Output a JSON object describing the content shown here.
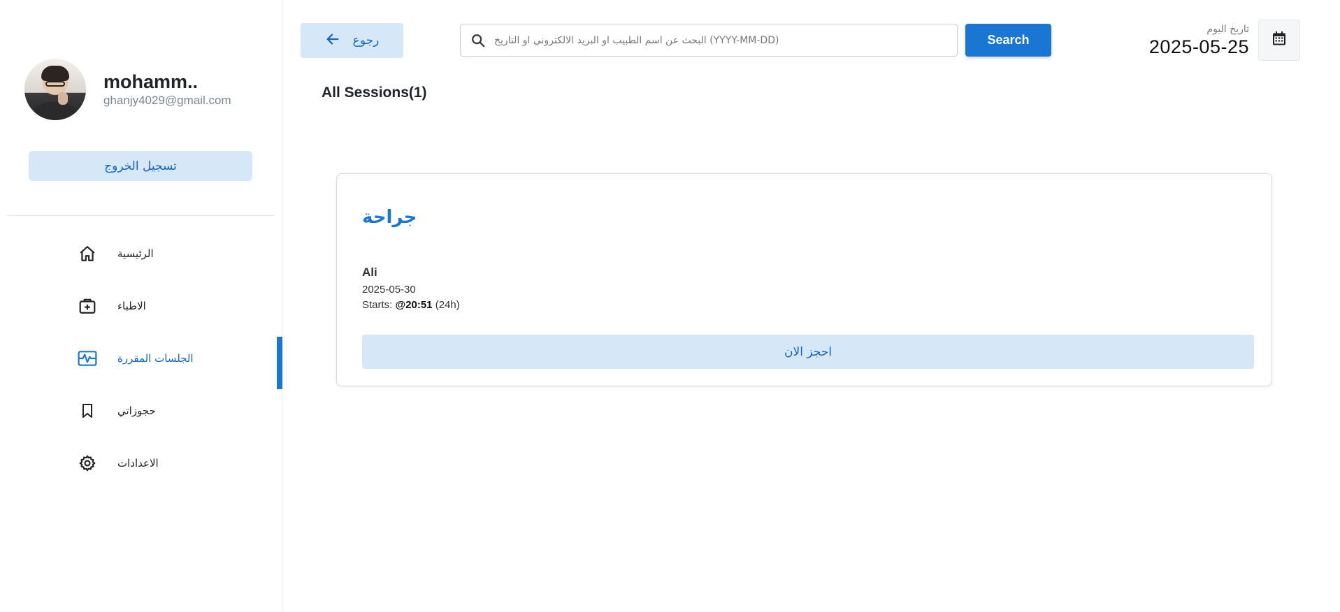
{
  "user": {
    "name": "mohamm..",
    "email": "ghanjy4029@gmail.com",
    "logout_label": "تسجيل الخروج"
  },
  "nav": {
    "items": [
      {
        "label": "الرئيسية",
        "icon": "home-icon",
        "active": false
      },
      {
        "label": "الاطباء",
        "icon": "medical-bag-icon",
        "active": false
      },
      {
        "label": "الجلسات المقررة",
        "icon": "sessions-icon",
        "active": true
      },
      {
        "label": "حجوزاتي",
        "icon": "bookmark-icon",
        "active": false
      },
      {
        "label": "الاعدادات",
        "icon": "gear-icon",
        "active": false
      }
    ]
  },
  "topbar": {
    "back_label": "رجوع",
    "search_placeholder": "البحث عن اسم الطبيب او البريد الالكتروني او التاريخ (YYYY-MM-DD)",
    "search_value": "",
    "search_button": "Search",
    "date_label": "تاريخ اليوم",
    "date_value": "2025-05-25"
  },
  "main": {
    "section_title": "All Sessions(1)",
    "sessions": [
      {
        "title": "جراحة",
        "doctor": "Ali",
        "date": "2025-05-30",
        "starts_prefix": "Starts:",
        "starts_time": "@20:51",
        "starts_suffix": "(24h)",
        "book_label": "احجز الان"
      }
    ]
  },
  "colors": {
    "accent": "#1976d2",
    "accent_light": "#d6e8f8",
    "text_link": "#1565c0"
  }
}
